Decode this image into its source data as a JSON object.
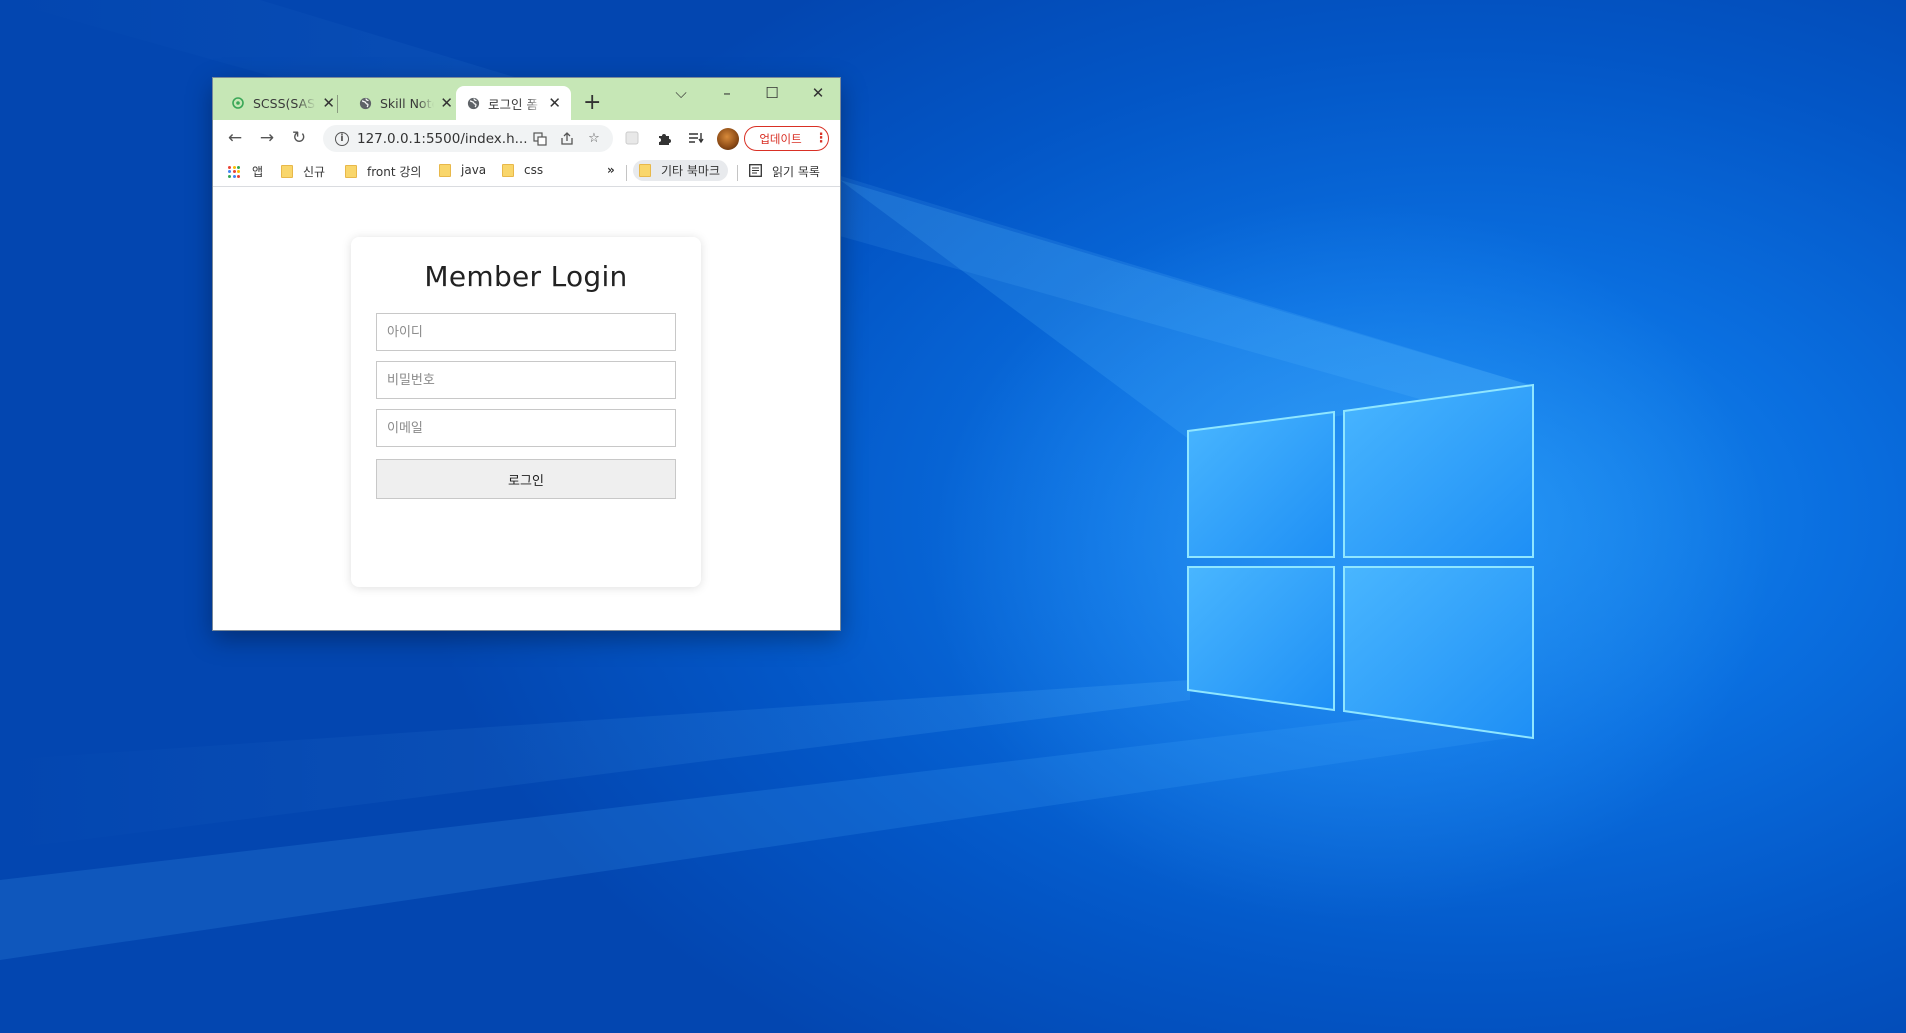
{
  "browser": {
    "tabs": [
      {
        "title": "SCSS(SASS)",
        "favicon": "scss-icon"
      },
      {
        "title": "Skill Note",
        "favicon": "globe-icon"
      },
      {
        "title": "로그인 폼",
        "favicon": "globe-icon",
        "active": true
      }
    ],
    "address": "127.0.0.1:5500/index.h...",
    "update_label": "업데이트"
  },
  "bookmarks": {
    "apps": "앱",
    "items": [
      "신규",
      "front 강의",
      "java",
      "css"
    ],
    "overflow": "»",
    "other": "기타 북마크",
    "reading_list": "읽기 목록"
  },
  "login": {
    "title": "Member Login",
    "id_placeholder": "아이디",
    "password_placeholder": "비밀번호",
    "email_placeholder": "이메일",
    "submit_label": "로그인"
  },
  "colors": {
    "titlebar": "#c6e7b6",
    "desktop_accent": "#0a6fe0",
    "update_red": "#d93025"
  }
}
